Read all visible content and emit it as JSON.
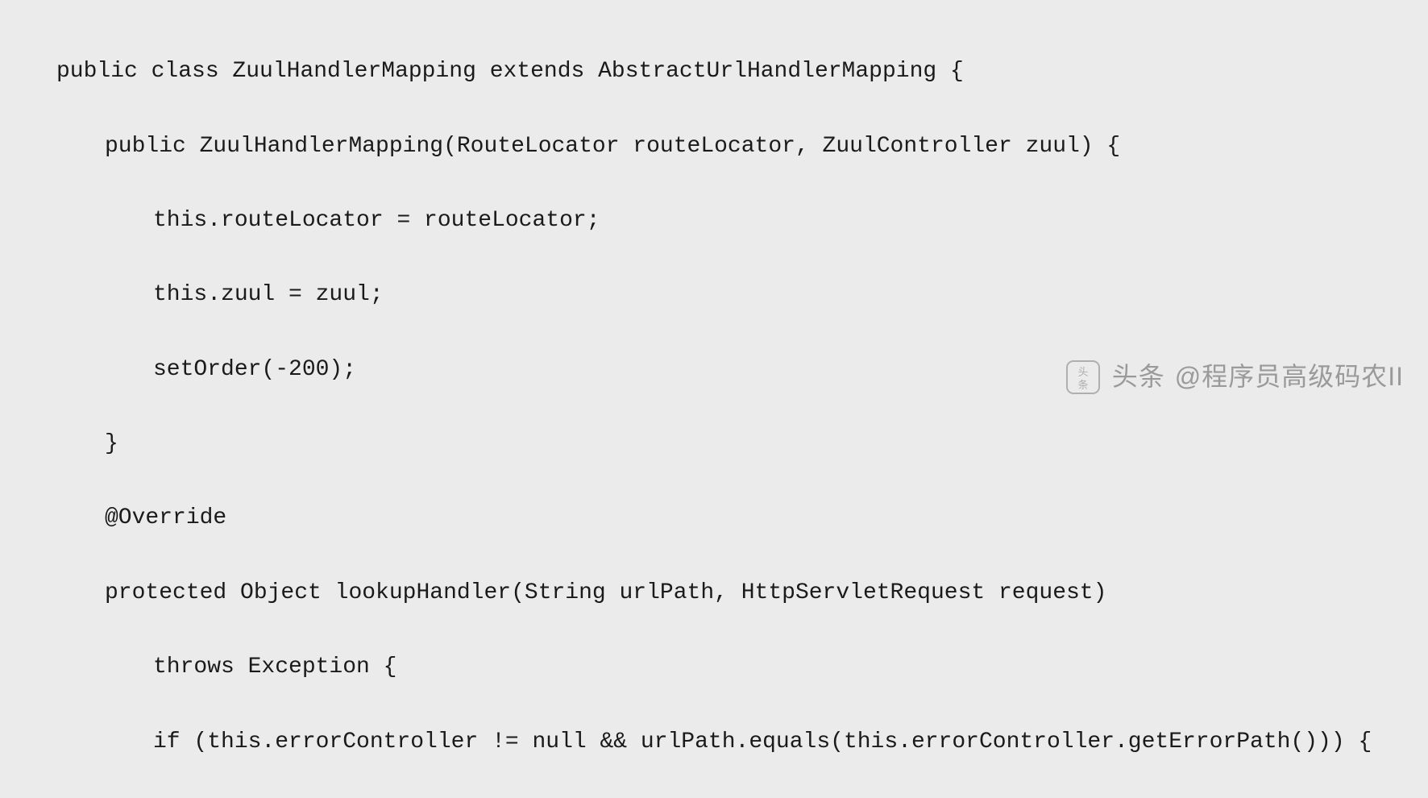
{
  "code": {
    "lines": [
      {
        "indent": 0,
        "text": "public class ZuulHandlerMapping extends AbstractUrlHandlerMapping {"
      },
      {
        "indent": 1,
        "text": "public ZuulHandlerMapping(RouteLocator routeLocator, ZuulController zuul) {"
      },
      {
        "indent": 2,
        "text": "this.routeLocator = routeLocator;"
      },
      {
        "indent": 2,
        "text": "this.zuul = zuul;"
      },
      {
        "indent": 2,
        "text": "setOrder(-200);"
      },
      {
        "indent": 1,
        "text": "}"
      },
      {
        "indent": 1,
        "text": "@Override"
      },
      {
        "indent": 1,
        "text": "protected Object lookupHandler(String urlPath, HttpServletRequest request)"
      },
      {
        "indent": 2,
        "text": "throws Exception {"
      },
      {
        "indent": 2,
        "text": "if (this.errorController != null && urlPath.equals(this.errorController.getErrorPath())) {"
      }
    ]
  },
  "watermark": {
    "prefix": "头条",
    "author": "@程序员高级码农II"
  }
}
